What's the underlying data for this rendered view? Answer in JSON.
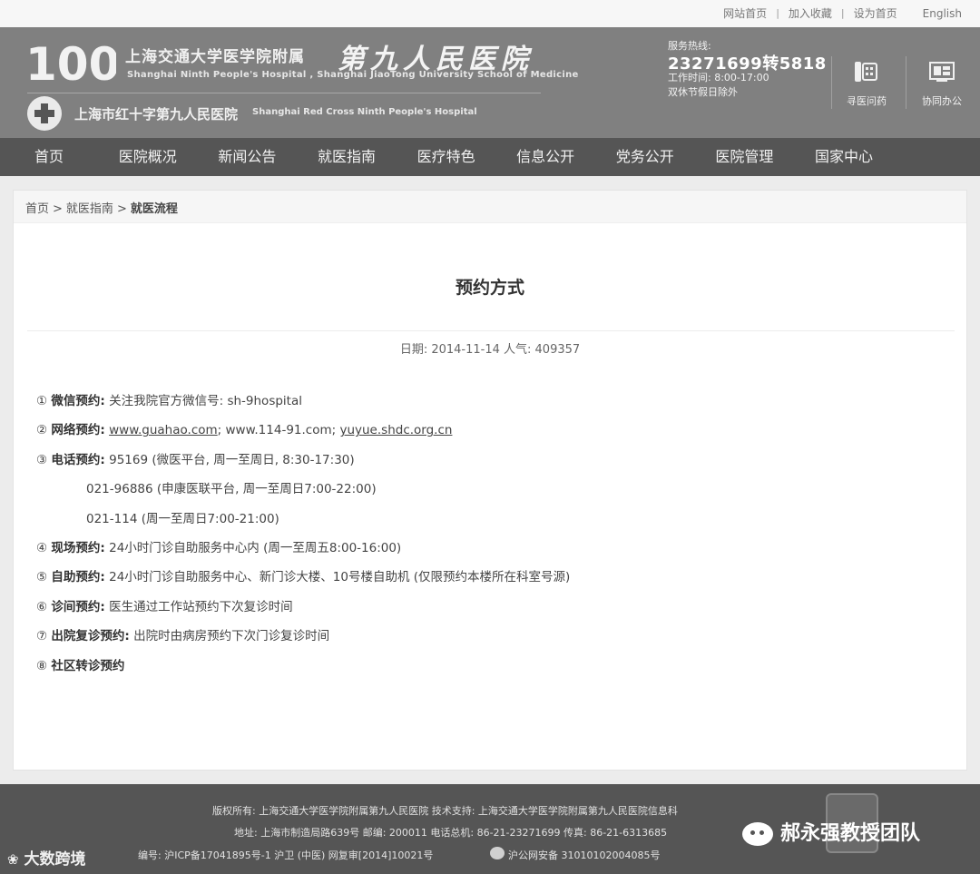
{
  "topbar": {
    "links": [
      "网站首页",
      "加入收藏",
      "设为首页",
      "English"
    ],
    "separator": "|"
  },
  "header": {
    "logo_100": "100",
    "hospital_cn": "上海交通大学医学院附属",
    "hospital_cn_big": "第九人民医院",
    "hospital_en": "Shanghai Ninth People's Hospital , Shanghai JiaoTong University School of Medicine",
    "redcross_cn": "上海市红十字第九人民医院",
    "redcross_en": "Shanghai Red Cross Ninth People's Hospital",
    "hotline_label": "服务热线:",
    "hotline_number": "23271699转5818",
    "hotline_hours": "工作时间: 8:00-17:00",
    "hotline_holiday": "双休节假日除外",
    "buttons": [
      {
        "label": "寻医问药",
        "icon": "phone-icon"
      },
      {
        "label": "协同办公",
        "icon": "office-icon"
      }
    ]
  },
  "nav": {
    "items": [
      "首页",
      "医院概况",
      "新闻公告",
      "就医指南",
      "医疗特色",
      "信息公开",
      "党务公开",
      "医院管理",
      "国家中心"
    ]
  },
  "breadcrumb": {
    "items": [
      "首页",
      "就医指南",
      "就医流程"
    ],
    "sep": ">"
  },
  "article": {
    "title": "预约方式",
    "meta": "日期: 2014-11-14 人气: 409357",
    "items": [
      {
        "num": "①",
        "label": "微信预约:",
        "text": "关注我院官方微信号: sh-9hospital"
      },
      {
        "num": "②",
        "label": "网络预约:",
        "link1": "www.guahao.com",
        "mid": "; www.114-91.com; ",
        "link2": "yuyue.shdc.org.cn"
      },
      {
        "num": "③",
        "label": "电话预约:",
        "text": "95169 (微医平台, 周一至周日, 8:30-17:30)"
      },
      {
        "indent": "021-96886 (申康医联平台, 周一至周日7:00-22:00)"
      },
      {
        "indent": "021-114 (周一至周日7:00-21:00)"
      },
      {
        "num": "④",
        "label": "现场预约:",
        "text": "24小时门诊自助服务中心内 (周一至周五8:00-16:00)"
      },
      {
        "num": "⑤",
        "label": "自助预约:",
        "text": "24小时门诊自助服务中心、新门诊大楼、10号楼自助机 (仅限预约本楼所在科室号源)"
      },
      {
        "num": "⑥",
        "label": "诊间预约:",
        "text": "医生通过工作站预约下次复诊时间"
      },
      {
        "num": "⑦",
        "label": "出院复诊预约:",
        "text": "出院时由病房预约下次门诊复诊时间"
      },
      {
        "num": "⑧",
        "label": "社区转诊预约",
        "text": ""
      }
    ]
  },
  "footer": {
    "line1": "版权所有: 上海交通大学医学院附属第九人民医院 技术支持: 上海交通大学医学院附属第九人民医院信息科",
    "line2": "地址: 上海市制造局路639号 邮编: 200011 电话总机: 86-21-23271699 传真: 86-21-6313685",
    "line3": "编号: 沪ICP备17041895号-1 沪卫 (中医) 网复审[2014]10021号",
    "line3b": "沪公网安备 31010102004085号",
    "watermark_left": "大数跨境",
    "watermark_right": "郝永强教授团队"
  }
}
